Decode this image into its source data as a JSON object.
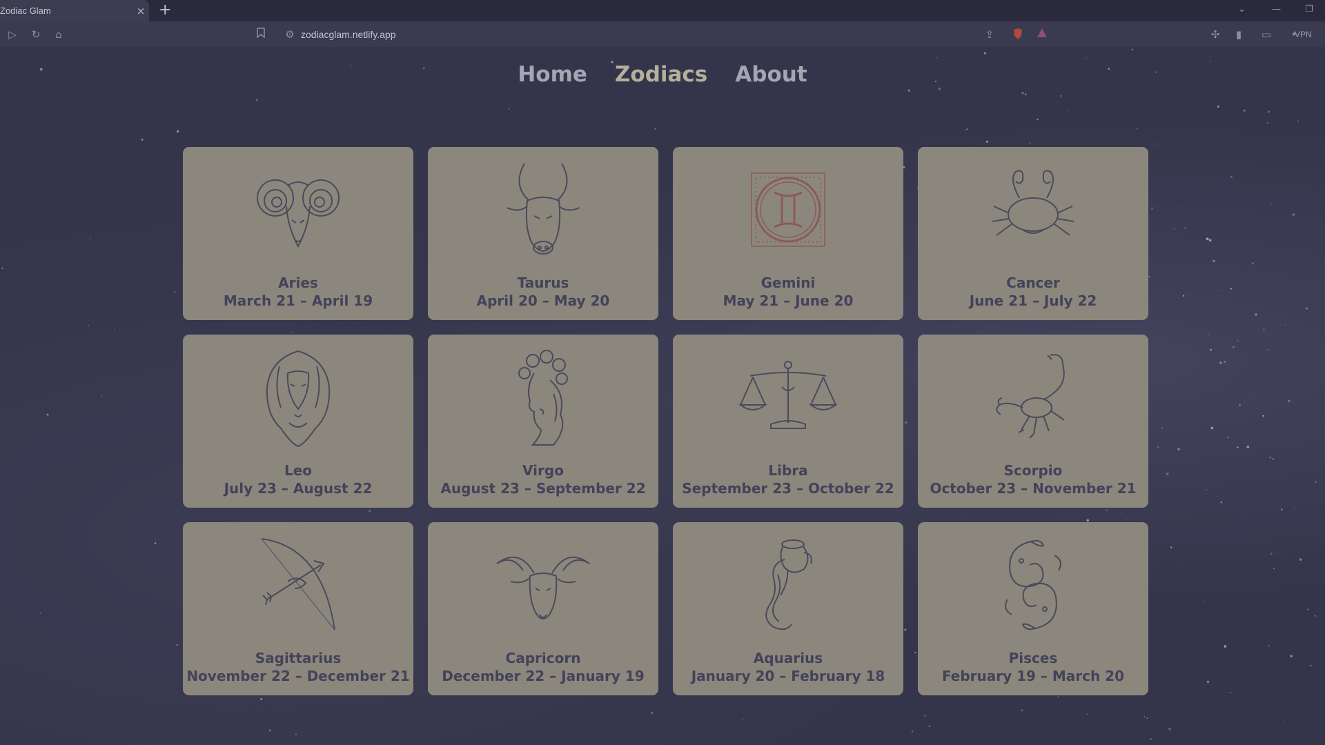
{
  "browser": {
    "tab_title": "Zodiac Glam",
    "tab_close": "×",
    "new_tab": "+",
    "url": "zodiacglam.netlify.app",
    "vpn_label": "VPN"
  },
  "nav": {
    "items": [
      {
        "label": "Home"
      },
      {
        "label": "Zodiacs"
      },
      {
        "label": "About"
      }
    ]
  },
  "signs": [
    {
      "name": "Aries",
      "dates": "March 21 – April 19",
      "icon": "ram-icon"
    },
    {
      "name": "Taurus",
      "dates": "April 20 – May 20",
      "icon": "bull-icon"
    },
    {
      "name": "Gemini",
      "dates": "May 21 – June 20",
      "icon": "gemini-glyph-icon"
    },
    {
      "name": "Cancer",
      "dates": "June 21 – July 22",
      "icon": "crab-icon"
    },
    {
      "name": "Leo",
      "dates": "July 23 – August 22",
      "icon": "lion-icon"
    },
    {
      "name": "Virgo",
      "dates": "August 23 – September 22",
      "icon": "maiden-icon"
    },
    {
      "name": "Libra",
      "dates": "September 23 – October 22",
      "icon": "scales-icon"
    },
    {
      "name": "Scorpio",
      "dates": "October 23 – November 21",
      "icon": "scorpion-icon"
    },
    {
      "name": "Sagittarius",
      "dates": "November 22 – December 21",
      "icon": "bow-arrow-icon"
    },
    {
      "name": "Capricorn",
      "dates": "December 22 – January 19",
      "icon": "goat-icon"
    },
    {
      "name": "Aquarius",
      "dates": "January 20 – February 18",
      "icon": "water-jug-icon"
    },
    {
      "name": "Pisces",
      "dates": "February 19 – March 20",
      "icon": "fish-icon"
    }
  ],
  "colors": {
    "card": "#8c877d",
    "card_text": "#43425a",
    "line_art": "#4a4a5c",
    "gemini_accent": "#8a5a5a"
  }
}
